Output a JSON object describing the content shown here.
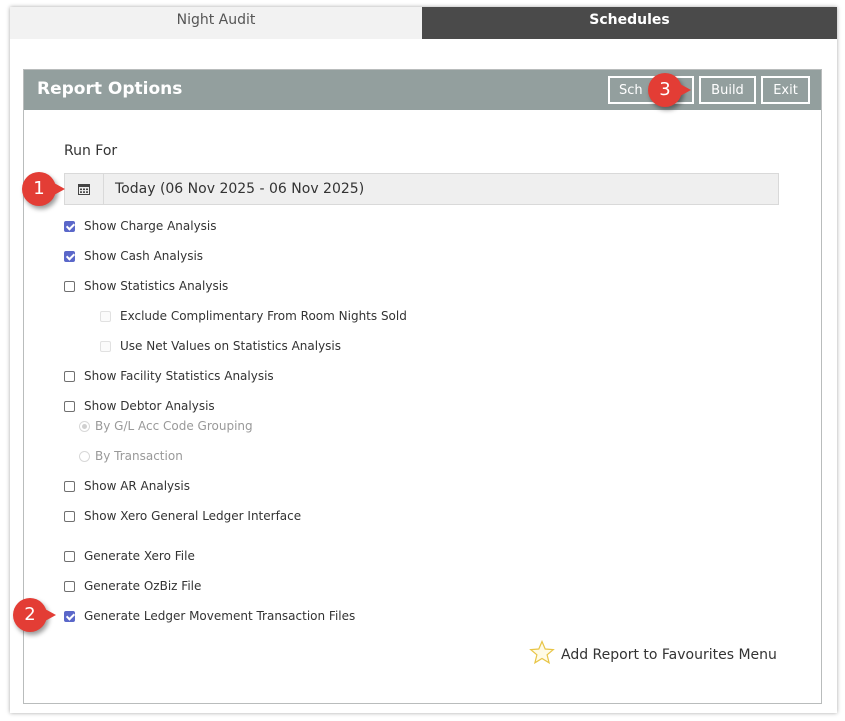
{
  "tabs": {
    "night_audit": "Night Audit",
    "schedules": "Schedules"
  },
  "panel": {
    "title": "Report Options",
    "buttons": {
      "schedule": "Sch",
      "build": "Build",
      "exit": "Exit"
    }
  },
  "run_for": {
    "label": "Run For",
    "value": "Today (06 Nov 2025 - 06 Nov 2025)",
    "icon": "calendar-icon"
  },
  "options": {
    "charge_analysis": {
      "label": "Show Charge Analysis",
      "checked": true
    },
    "cash_analysis": {
      "label": "Show Cash Analysis",
      "checked": true
    },
    "statistics_analysis": {
      "label": "Show Statistics Analysis",
      "checked": false
    },
    "exclude_complimentary": {
      "label": "Exclude Complimentary From Room Nights Sold",
      "checked": false
    },
    "use_net_values": {
      "label": "Use Net Values on Statistics Analysis",
      "checked": false
    },
    "facility_statistics": {
      "label": "Show Facility Statistics Analysis",
      "checked": false
    },
    "debtor_analysis": {
      "label": "Show Debtor Analysis",
      "checked": false
    },
    "by_gl_grouping": {
      "label": "By G/L Acc Code Grouping",
      "selected": true
    },
    "by_transaction": {
      "label": "By Transaction",
      "selected": false
    },
    "ar_analysis": {
      "label": "Show AR Analysis",
      "checked": false
    },
    "xero_gl_interface": {
      "label": "Show Xero General Ledger Interface",
      "checked": false
    },
    "generate_xero": {
      "label": "Generate Xero File",
      "checked": false
    },
    "generate_ozbiz": {
      "label": "Generate OzBiz File",
      "checked": false
    },
    "generate_ledger_movement": {
      "label": "Generate Ledger Movement Transaction Files",
      "checked": true
    }
  },
  "favourites": {
    "label": "Add Report to Favourites Menu",
    "icon": "star-icon"
  },
  "markers": [
    "1",
    "2",
    "3"
  ],
  "colors": {
    "header_bg": "#939f9e",
    "checkbox_checked": "#5a67c9",
    "marker": "#e33d35",
    "active_tab": "#4a4a4a"
  }
}
